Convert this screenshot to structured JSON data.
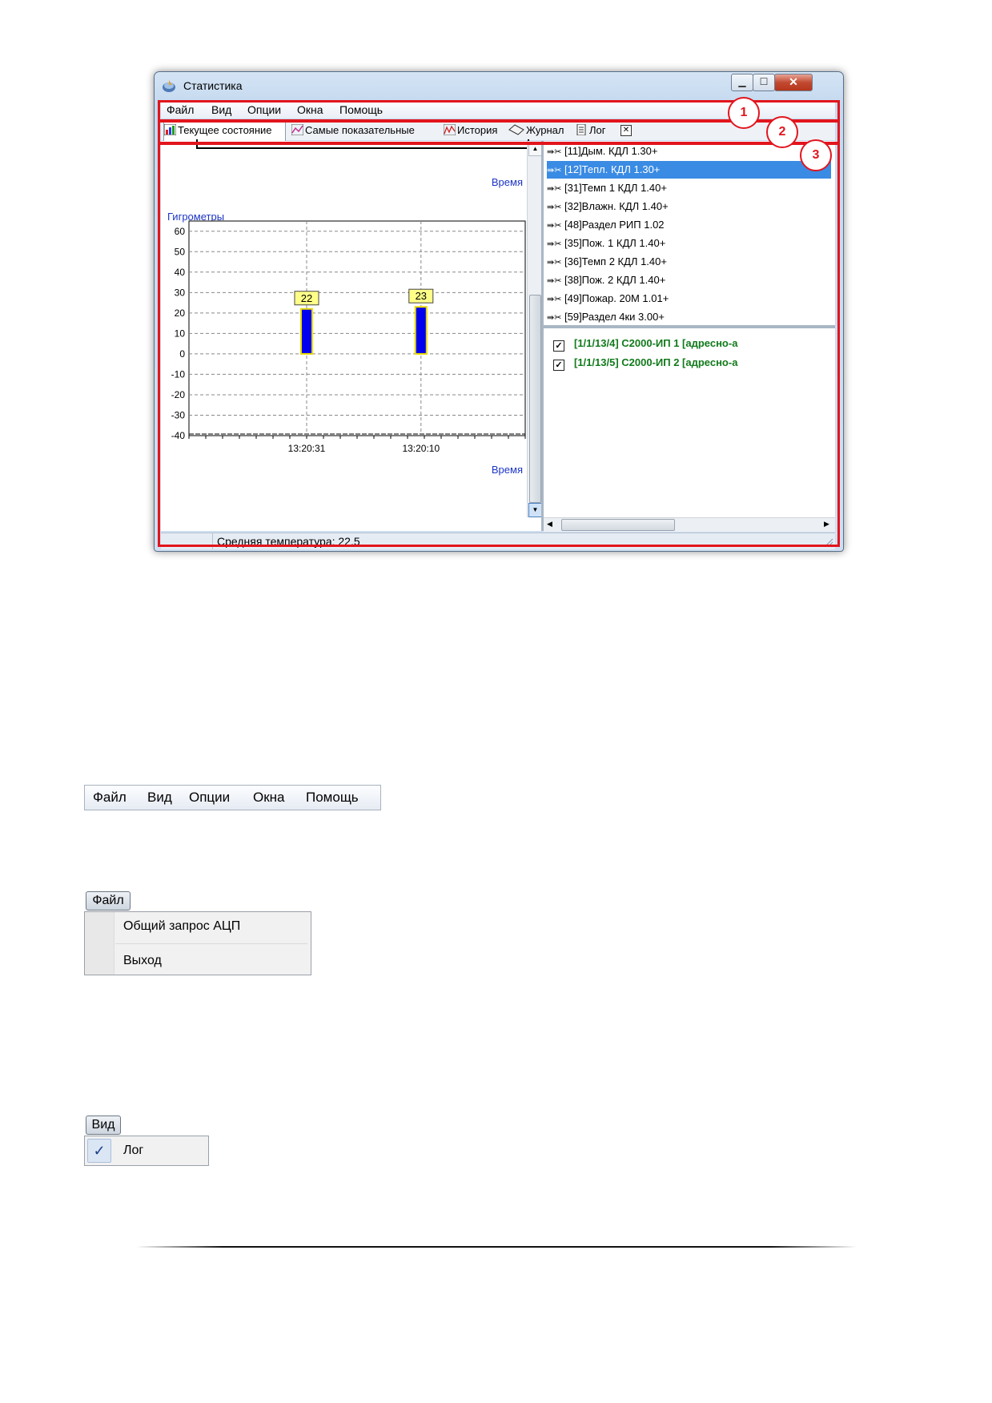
{
  "window": {
    "title": "Статистика",
    "caption_buttons": {
      "minimize": "▁",
      "maximize": "☐",
      "close": "✕"
    }
  },
  "menubar": {
    "items": [
      "Файл",
      "Вид",
      "Опции",
      "Окна",
      "Помощь"
    ]
  },
  "tabs": [
    {
      "label": "Текущее состояние",
      "icon": "bar-chart-icon",
      "active": true
    },
    {
      "label": "Самые показательные",
      "icon": "line-chart-icon",
      "active": false
    },
    {
      "label": "История",
      "icon": "history-chart-icon",
      "active": false
    },
    {
      "label": "Журнал",
      "icon": "journal-icon",
      "active": false
    },
    {
      "label": "Лог",
      "icon": "log-icon",
      "active": false
    }
  ],
  "tab_close": "✕",
  "chart": {
    "top_axis_label": "Время",
    "title": "Гигрометры",
    "xlabel": "Время"
  },
  "chart_data": {
    "type": "bar",
    "title": "Гигрометры",
    "xlabel": "Время",
    "ylabel": "",
    "categories": [
      "13:20:31",
      "13:20:10"
    ],
    "values": [
      22,
      23
    ],
    "data_labels": [
      "22",
      "23"
    ],
    "ylim": [
      -40,
      65
    ],
    "yticks": [
      60,
      50,
      40,
      30,
      20,
      10,
      0,
      -10,
      -20,
      -30,
      -40
    ],
    "grid": true,
    "bar_color": "#0000ee",
    "bar_edge": "#e8d800",
    "label_bg": "#ffff88"
  },
  "tree": {
    "items": [
      {
        "label": "[11]Дым. КДЛ 1.30+",
        "selected": false
      },
      {
        "label": "[12]Тепл. КДЛ 1.30+",
        "selected": true
      },
      {
        "label": "[31]Темп 1 КДЛ 1.40+",
        "selected": false
      },
      {
        "label": "[32]Влажн. КДЛ 1.40+",
        "selected": false
      },
      {
        "label": "[48]Раздел РИП 1.02",
        "selected": false
      },
      {
        "label": "[35]Пож. 1 КДЛ 1.40+",
        "selected": false
      },
      {
        "label": "[36]Темп 2 КДЛ 1.40+",
        "selected": false
      },
      {
        "label": "[38]Пож. 2 КДЛ 1.40+",
        "selected": false
      },
      {
        "label": "[49]Пожар. 20М 1.01+",
        "selected": false
      },
      {
        "label": "[59]Раздел 4ки 3.00+",
        "selected": false
      }
    ]
  },
  "checklist": {
    "items": [
      {
        "label": "[1/1/13/4] С2000-ИП 1 [адресно-а",
        "checked": true
      },
      {
        "label": "[1/1/13/5] С2000-ИП 2 [адресно-а",
        "checked": true
      }
    ]
  },
  "statusbar": {
    "text": "Средняя температура: 22,5"
  },
  "annotations": [
    "1",
    "2",
    "3"
  ],
  "menu_crop": {
    "items": [
      "Файл",
      "Вид",
      "Опции",
      "Окна",
      "Помощь"
    ]
  },
  "file_menu": {
    "header": "Файл",
    "items": [
      "Общий запрос АЦП",
      "Выход"
    ]
  },
  "view_menu": {
    "header": "Вид",
    "items": [
      {
        "label": "Лог",
        "checked": true
      }
    ],
    "check_mark": "✓"
  },
  "colors": {
    "annotation_red": "#e2151d",
    "selection_blue": "#3a8be3",
    "check_green": "#117a1b"
  }
}
